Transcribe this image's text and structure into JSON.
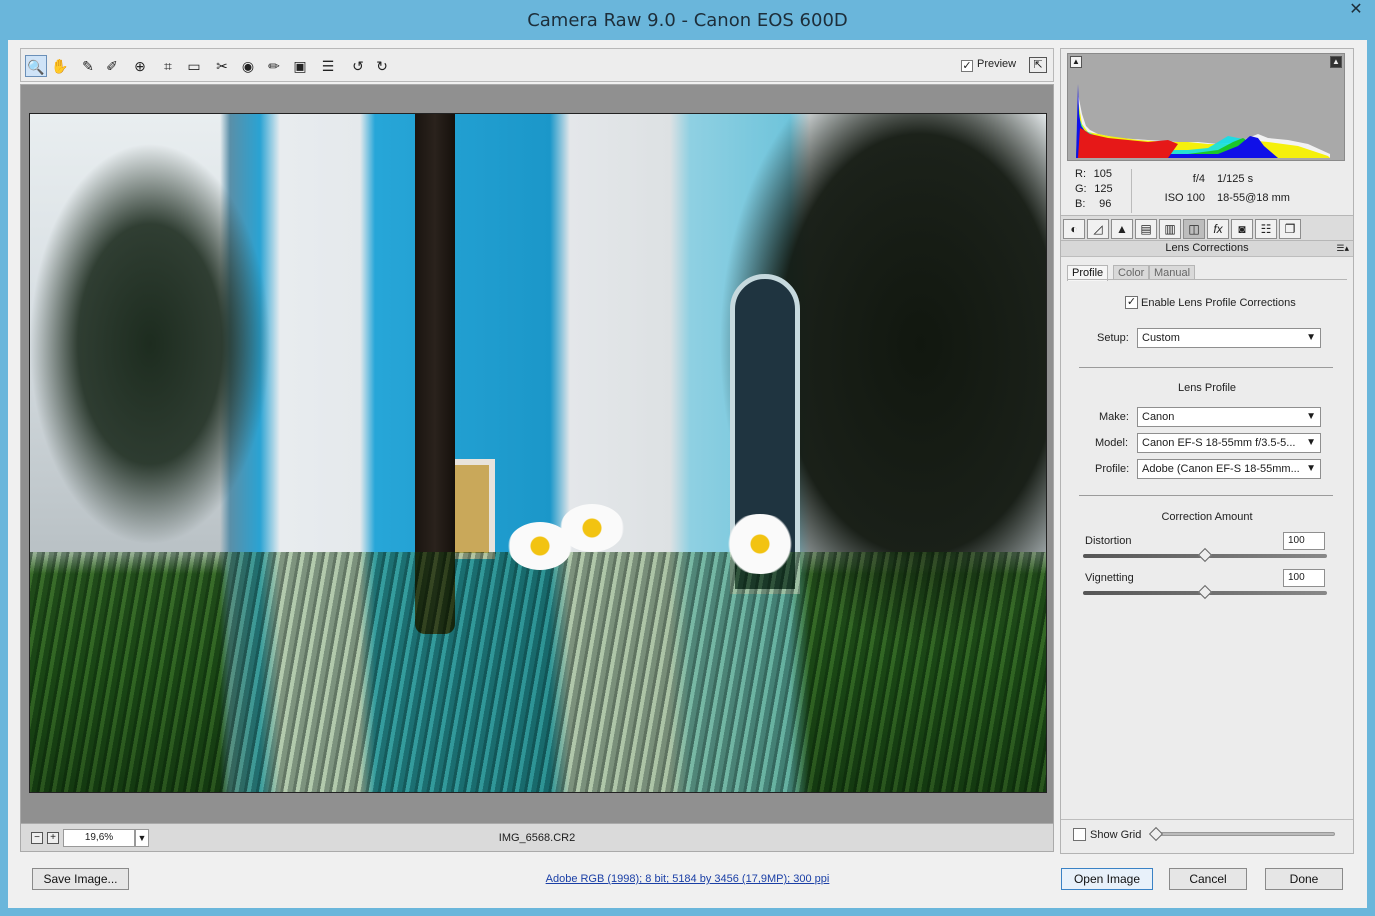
{
  "window": {
    "title": "Camera Raw 9.0  -  Canon EOS 600D",
    "close_glyph": "✕"
  },
  "toolbar": {
    "preview_label": "Preview",
    "preview_checked": true,
    "tools": [
      {
        "name": "zoom-tool-icon",
        "glyph": "🔍"
      },
      {
        "name": "hand-tool-icon",
        "glyph": "✋"
      },
      {
        "name": "white-balance-tool-icon",
        "glyph": "✎"
      },
      {
        "name": "color-sampler-tool-icon",
        "glyph": "✐"
      },
      {
        "name": "targeted-adjustment-tool-icon",
        "glyph": "⊕"
      },
      {
        "name": "crop-tool-icon",
        "glyph": "⌗"
      },
      {
        "name": "straighten-tool-icon",
        "glyph": "▭"
      },
      {
        "name": "spot-removal-tool-icon",
        "glyph": "✂"
      },
      {
        "name": "red-eye-removal-icon",
        "glyph": "◉"
      },
      {
        "name": "adjustment-brush-icon",
        "glyph": "✏"
      },
      {
        "name": "graduated-filter-icon",
        "glyph": "▣"
      },
      {
        "name": "preferences-list-icon",
        "glyph": "☰"
      },
      {
        "name": "rotate-left-icon",
        "glyph": "↺"
      },
      {
        "name": "rotate-right-icon",
        "glyph": "↻"
      }
    ]
  },
  "image_status": {
    "zoom_value": "19,6%",
    "filename": "IMG_6568.CR2"
  },
  "readout": {
    "r_label": "R:",
    "r_value": "105",
    "g_label": "G:",
    "g_value": "125",
    "b_label": "B:",
    "b_value": "96",
    "aperture": "f/4",
    "shutter": "1/125 s",
    "iso": "ISO 100",
    "lens": "18-55@18 mm"
  },
  "panel": {
    "section_title": "Lens Corrections",
    "subtabs": [
      "Profile",
      "Color",
      "Manual"
    ],
    "enable_label": "Enable Lens Profile Corrections",
    "enable_checked": true,
    "setup_label": "Setup:",
    "setup_value": "Custom",
    "lens_profile_heading": "Lens Profile",
    "make_label": "Make:",
    "make_value": "Canon",
    "model_label": "Model:",
    "model_value": "Canon EF-S 18-55mm f/3.5-5...",
    "profile_label": "Profile:",
    "profile_value": "Adobe (Canon EF-S 18-55mm...",
    "correction_heading": "Correction Amount",
    "distortion_label": "Distortion",
    "distortion_value": "100",
    "distortion_slider_pct": 50,
    "vignetting_label": "Vignetting",
    "vignetting_value": "100",
    "vignetting_slider_pct": 50,
    "show_grid_label": "Show Grid",
    "show_grid_checked": false
  },
  "panel_tabs": [
    {
      "name": "basic-tab-icon",
      "glyph": "◐"
    },
    {
      "name": "tone-curve-tab-icon",
      "glyph": "◿"
    },
    {
      "name": "detail-tab-icon",
      "glyph": "▲"
    },
    {
      "name": "hsl-tab-icon",
      "glyph": "▤"
    },
    {
      "name": "split-toning-tab-icon",
      "glyph": "▥"
    },
    {
      "name": "lens-corrections-tab-icon",
      "glyph": "◫"
    },
    {
      "name": "effects-tab-icon",
      "glyph": "fx"
    },
    {
      "name": "camera-calibration-tab-icon",
      "glyph": "◙"
    },
    {
      "name": "presets-tab-icon",
      "glyph": "☷"
    },
    {
      "name": "snapshots-tab-icon",
      "glyph": "❐"
    }
  ],
  "footer": {
    "save_label": "Save Image...",
    "info_link": "Adobe RGB (1998); 8 bit; 5184 by 3456 (17,9MP); 300 ppi",
    "open_label": "Open Image",
    "cancel_label": "Cancel",
    "done_label": "Done"
  },
  "colors": {
    "accent": "#6ab6db",
    "link": "#1a3fa6",
    "default_button_border": "#3a82c5"
  }
}
